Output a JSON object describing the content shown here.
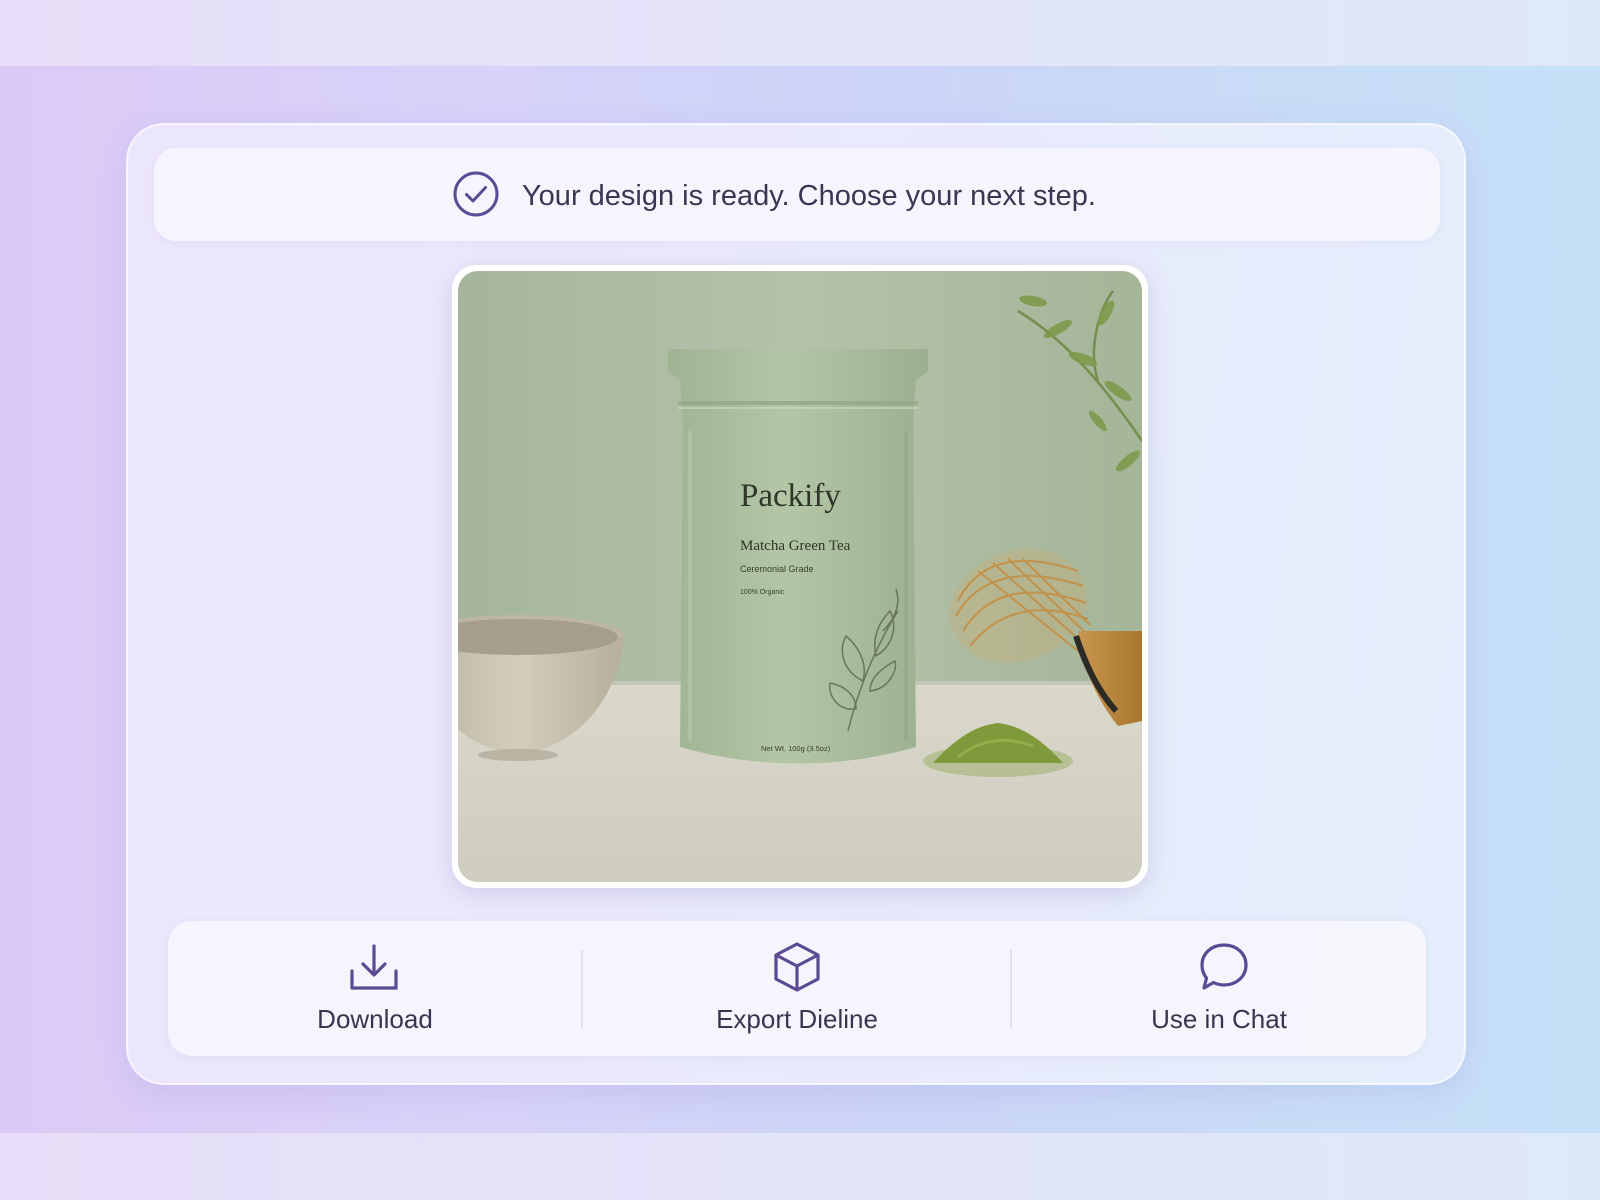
{
  "banner": {
    "message": "Your design is ready. Choose your next step.",
    "icon": "check-circle-icon"
  },
  "preview": {
    "brand": "Packify",
    "product_name": "Matcha Green Tea",
    "grade": "Ceremonial Grade",
    "organic": "100% Organic",
    "net_weight": "Net Wt. 100g (3.5oz)"
  },
  "actions": [
    {
      "label": "Download",
      "icon": "download-icon"
    },
    {
      "label": "Export Dieline",
      "icon": "cube-icon"
    },
    {
      "label": "Use in Chat",
      "icon": "chat-bubble-icon"
    }
  ],
  "colors": {
    "accent": "#5b4a94",
    "text": "#3d3553",
    "pouch": "#a9bf9d",
    "matcha": "#7f9a3a"
  }
}
